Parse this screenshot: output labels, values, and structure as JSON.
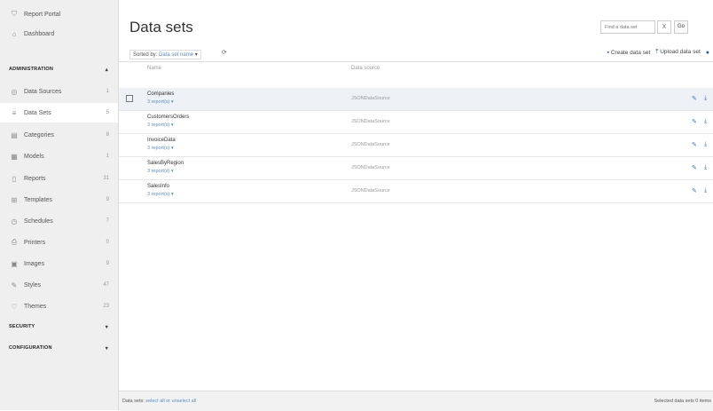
{
  "sidebar": {
    "top_items": [
      {
        "icon": "shield-icon",
        "label": "Report Portal"
      },
      {
        "icon": "dashboard-icon",
        "label": "Dashboard"
      }
    ],
    "sections": {
      "administration": "ADMINISTRATION",
      "security": "SECURITY",
      "configuration": "CONFIGURATION"
    },
    "admin_items": [
      {
        "icon": "database-icon",
        "label": "Data Sources",
        "count": "1"
      },
      {
        "icon": "list-icon",
        "label": "Data Sets",
        "count": "5"
      },
      {
        "icon": "chart-icon",
        "label": "Categories",
        "count": "8"
      },
      {
        "icon": "grid-icon",
        "label": "Models",
        "count": "1"
      },
      {
        "icon": "report-icon",
        "label": "Reports",
        "count": "31"
      },
      {
        "icon": "template-icon",
        "label": "Templates",
        "count": "9"
      },
      {
        "icon": "clock-icon",
        "label": "Schedules",
        "count": "7"
      },
      {
        "icon": "printer-icon",
        "label": "Printers",
        "count": "0"
      },
      {
        "icon": "image-icon",
        "label": "Images",
        "count": "9"
      },
      {
        "icon": "brush-icon",
        "label": "Styles",
        "count": "47"
      },
      {
        "icon": "heart-icon",
        "label": "Themes",
        "count": "23"
      }
    ]
  },
  "main": {
    "title": "Data sets",
    "search": {
      "placeholder": "Find a data set",
      "clear": "X",
      "go": "Go"
    },
    "sort": {
      "label": "Sorted by:",
      "value": "Data set name",
      "arrow": "▾"
    },
    "actions": {
      "create": "Create data set",
      "upload": "Upload data set"
    },
    "columns": {
      "name": "Name",
      "source": "Data source"
    },
    "rows": [
      {
        "name": "Companies",
        "reports": "3 report(s) ▾",
        "source": "JSONDataSource"
      },
      {
        "name": "CustomersOrders",
        "reports": "3 report(s) ▾",
        "source": "JSONDataSource"
      },
      {
        "name": "InvoiceData",
        "reports": "3 report(s) ▾",
        "source": "JSONDataSource"
      },
      {
        "name": "SalesByRegion",
        "reports": "3 report(s) ▾",
        "source": "JSONDataSource"
      },
      {
        "name": "SalesInfo",
        "reports": "3 report(s) ▾",
        "source": "JSONDataSource"
      }
    ]
  },
  "footer": {
    "left_label": "Data sets:",
    "select_all": "select all",
    "or": "or",
    "unselect_all": "unselect all",
    "right": "Selected data sets 0 items"
  }
}
